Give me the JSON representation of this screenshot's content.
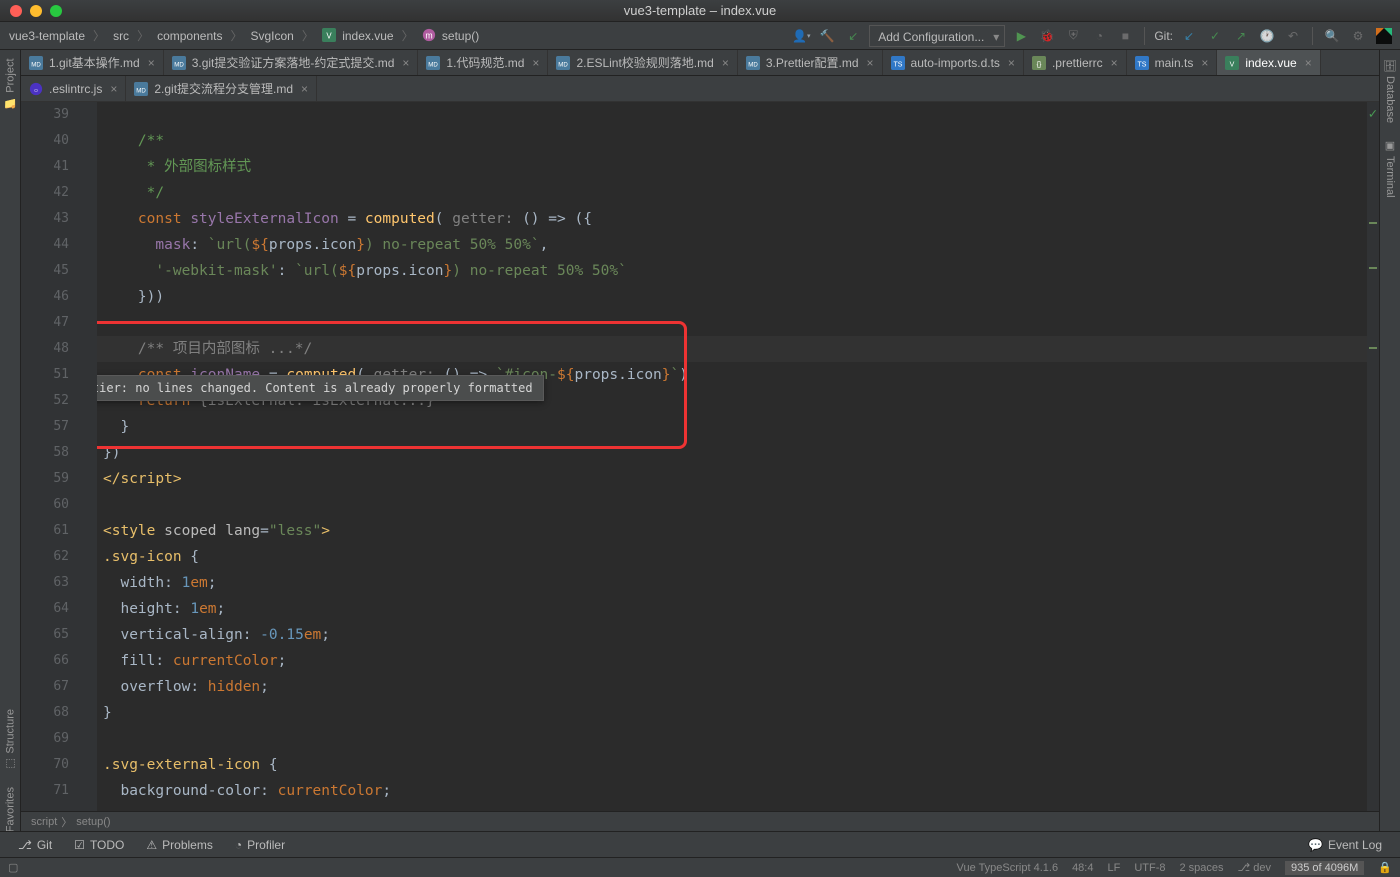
{
  "titlebar": {
    "title": "vue3-template – index.vue"
  },
  "breadcrumbs": {
    "items": [
      "vue3-template",
      "src",
      "components",
      "SvgIcon",
      "index.vue",
      "setup()"
    ]
  },
  "toolbar": {
    "config_dropdown": "Add Configuration...",
    "git_label": "Git:"
  },
  "tabs": {
    "row1": [
      {
        "label": "1.git基本操作.md"
      },
      {
        "label": "3.git提交验证方案落地-约定式提交.md"
      },
      {
        "label": "1.代码规范.md"
      },
      {
        "label": "2.ESLint校验规则落地.md"
      },
      {
        "label": "3.Prettier配置.md"
      },
      {
        "label": "auto-imports.d.ts"
      },
      {
        "label": ".prettierrc"
      },
      {
        "label": "main.ts"
      },
      {
        "label": "index.vue",
        "active": true
      }
    ],
    "row2": [
      {
        "label": ".eslintrc.js"
      },
      {
        "label": "2.git提交流程分支管理.md"
      }
    ]
  },
  "left_tool_windows": {
    "project": "Project",
    "structure": "Structure",
    "favorites": "Favorites"
  },
  "right_tool_windows": {
    "database": "Database",
    "terminal": "Terminal"
  },
  "editor": {
    "line_start": 39,
    "lines": [
      {
        "n": 39,
        "html": ""
      },
      {
        "n": 40,
        "html": "    <span class='c-com-doc'>/**</span>"
      },
      {
        "n": 41,
        "html": "    <span class='c-com-doc'> * 外部图标样式</span>"
      },
      {
        "n": 42,
        "html": "    <span class='c-com-doc'> */</span>"
      },
      {
        "n": 43,
        "html": "    <span class='c-kw'>const</span> <span class='c-id'>styleExternalIcon</span> <span class='c-op'>=</span> <span class='c-fn'>computed</span>( <span class='c-com'>getter:</span> () <span class='c-op'>=&gt;</span> ({"
      },
      {
        "n": 44,
        "html": "      <span class='c-id'>mask</span>: <span class='c-str'>`url(</span><span class='c-tpl'>${</span>props.icon<span class='c-tpl'>}</span><span class='c-str'>) no-repeat 50% 50%`</span>,"
      },
      {
        "n": 45,
        "html": "      <span class='c-str'>'-webkit-mask'</span>: <span class='c-str'>`url(</span><span class='c-tpl'>${</span>props.icon<span class='c-tpl'>}</span><span class='c-str'>) no-repeat 50% 50%`</span>"
      },
      {
        "n": 46,
        "html": "    }))"
      },
      {
        "n": 47,
        "html": ""
      },
      {
        "n": 48,
        "html": "    <span class='c-com'>/** 项目内部图标 ...*/</span>",
        "current": true
      },
      {
        "n": 51,
        "html": "    <span class='c-kw'>const</span> <span class='c-id'>iconName</span> <span class='c-op'>=</span> <span class='c-fn'>computed</span>( <span class='c-com'>getter:</span> () <span class='c-op'>=&gt;</span> <span class='c-str'>`#icon-</span><span class='c-tpl'>${</span>props.icon<span class='c-tpl'>}</span><span class='c-str'>`</span>)"
      },
      {
        "n": 52,
        "html": "    <span class='c-kw'>return</span> <span class='c-com'>{isExternal: isExternal...}</span>"
      },
      {
        "n": 57,
        "html": "  }"
      },
      {
        "n": 58,
        "html": "})"
      },
      {
        "n": 59,
        "html": "<span class='c-tag'>&lt;/script&gt;</span>"
      },
      {
        "n": 60,
        "html": ""
      },
      {
        "n": 61,
        "html": "<span class='c-tag'>&lt;style</span> <span class='c-attr'>scoped lang</span>=<span class='c-str'>\"less\"</span><span class='c-tag'>&gt;</span>"
      },
      {
        "n": 62,
        "html": "<span class='c-sel'>.svg-icon</span> {"
      },
      {
        "n": 63,
        "html": "  <span class='c-prop'>width</span>: <span class='c-num'>1</span><span class='c-kw'>em</span>;"
      },
      {
        "n": 64,
        "html": "  <span class='c-prop'>height</span>: <span class='c-num'>1</span><span class='c-kw'>em</span>;"
      },
      {
        "n": 65,
        "html": "  <span class='c-prop'>vertical-align</span>: <span class='c-num'>-0.15</span><span class='c-kw'>em</span>;"
      },
      {
        "n": 66,
        "html": "  <span class='c-prop'>fill</span>: <span class='c-hl'>currentColor</span>;"
      },
      {
        "n": 67,
        "html": "  <span class='c-prop'>overflow</span>: <span class='c-hl'>hidden</span>;"
      },
      {
        "n": 68,
        "html": "}"
      },
      {
        "n": 69,
        "html": ""
      },
      {
        "n": 70,
        "html": "<span class='c-sel'>.svg-external-icon</span> {"
      },
      {
        "n": 71,
        "html": "  <span class='c-prop'>background-color</span>: <span class='c-hl'>currentColor</span>;"
      }
    ],
    "tooltip": "Prettier: no lines changed. Content is already properly formatted"
  },
  "breadcrumbs_bottom": {
    "items": [
      "script",
      "setup()"
    ]
  },
  "bottom_tools": {
    "git": "Git",
    "todo": "TODO",
    "problems": "Problems",
    "profiler": "Profiler",
    "event_log": "Event Log"
  },
  "status_bar": {
    "vue_ts": "Vue TypeScript 4.1.6",
    "pos": "48:4",
    "le": "LF",
    "enc": "UTF-8",
    "indent": "2 spaces",
    "branch": "dev",
    "mem": "935 of 4096M"
  }
}
